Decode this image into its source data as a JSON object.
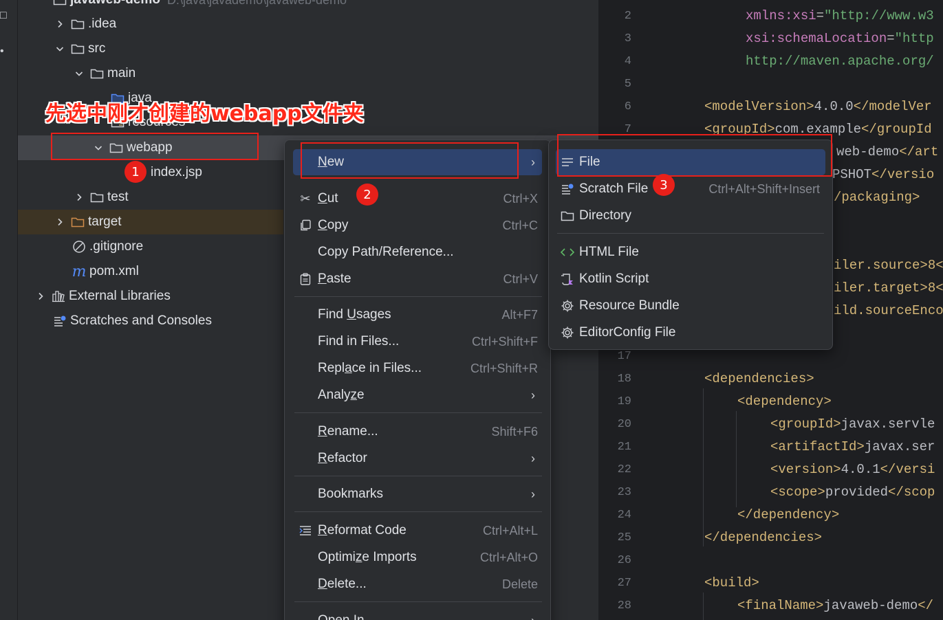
{
  "tree": {
    "root_label": "javaweb-demo",
    "root_path": "D:\\java\\javademo\\javaweb-demo",
    "items": [
      {
        "label": ".idea"
      },
      {
        "label": "src"
      },
      {
        "label": "main"
      },
      {
        "label": "java"
      },
      {
        "label": "resources"
      },
      {
        "label": "webapp"
      },
      {
        "label": "index.jsp"
      },
      {
        "label": "test"
      },
      {
        "label": "target"
      },
      {
        "label": ".gitignore"
      },
      {
        "label": "pom.xml"
      },
      {
        "label": "External Libraries"
      },
      {
        "label": "Scratches and Consoles"
      }
    ]
  },
  "annotation": {
    "callout": "先选中刚才创建的webapp文件夹",
    "badges": [
      "1",
      "2",
      "3"
    ]
  },
  "context_menu": {
    "items": [
      {
        "label": "New",
        "mnemonic_prefix": "",
        "mnemonic": "N",
        "rest": "ew",
        "shortcut": "",
        "submenu": true
      },
      {
        "label": "Cut",
        "prefix": "",
        "mnemonic": "C",
        "rest": "ut",
        "shortcut": "Ctrl+X"
      },
      {
        "label": "Copy",
        "prefix": "",
        "mnemonic": "C",
        "rest": "opy",
        "shortcut": "Ctrl+C"
      },
      {
        "label": "Copy Path/Reference...",
        "shortcut": ""
      },
      {
        "label": "Paste",
        "prefix": "",
        "mnemonic": "P",
        "rest": "aste",
        "shortcut": "Ctrl+V"
      },
      {
        "label": "Find Usages",
        "prefix": "Find ",
        "mnemonic": "U",
        "rest": "sages",
        "shortcut": "Alt+F7"
      },
      {
        "label": "Find in Files...",
        "shortcut": "Ctrl+Shift+F"
      },
      {
        "label": "Replace in Files...",
        "prefix": "Repl",
        "mnemonic": "a",
        "rest": "ce in Files...",
        "shortcut": "Ctrl+Shift+R"
      },
      {
        "label": "Analyze",
        "prefix": "Analy",
        "mnemonic": "z",
        "rest": "e",
        "submenu": true
      },
      {
        "label": "Rename...",
        "prefix": "",
        "mnemonic": "R",
        "rest": "ename...",
        "shortcut": "Shift+F6"
      },
      {
        "label": "Refactor",
        "prefix": "",
        "mnemonic": "R",
        "rest": "efactor",
        "submenu": true
      },
      {
        "label": "Bookmarks",
        "submenu": true
      },
      {
        "label": "Reformat Code",
        "prefix": "",
        "mnemonic": "R",
        "rest": "eformat Code",
        "shortcut": "Ctrl+Alt+L"
      },
      {
        "label": "Optimize Imports",
        "prefix": "Optimi",
        "mnemonic": "z",
        "rest": "e Imports",
        "shortcut": "Ctrl+Alt+O"
      },
      {
        "label": "Delete...",
        "prefix": "",
        "mnemonic": "D",
        "rest": "elete...",
        "shortcut": "Delete"
      },
      {
        "label": "Open In",
        "submenu": true
      }
    ]
  },
  "new_submenu": {
    "items": [
      {
        "label": "File",
        "shortcut": ""
      },
      {
        "label": "Scratch File",
        "shortcut": "Ctrl+Alt+Shift+Insert"
      },
      {
        "label": "Directory",
        "shortcut": ""
      },
      {
        "label": "HTML File",
        "shortcut": ""
      },
      {
        "label": "Kotlin Script",
        "shortcut": ""
      },
      {
        "label": "Resource Bundle",
        "shortcut": ""
      },
      {
        "label": "EditorConfig File",
        "shortcut": ""
      }
    ]
  },
  "editor": {
    "line_numbers": [
      "2",
      "3",
      "4",
      "5",
      "6",
      "7",
      "17",
      "18",
      "19",
      "20",
      "21",
      "22",
      "23",
      "24",
      "25",
      "26",
      "27",
      "28"
    ],
    "lines": {
      "l2": {
        "ns": "xmlns:xsi",
        "eq": "=",
        "val": "\"http://www.w3"
      },
      "l3": {
        "ns": "xsi:schemaLocation",
        "eq": "=",
        "val": "\"http"
      },
      "l4": {
        "val": "http://maven.apache.org/"
      },
      "l6": {
        "open": "<modelVersion>",
        "text": "4.0.0",
        "close": "</modelVer"
      },
      "l7": {
        "open": "<groupId>",
        "text": "com.example",
        "close": "</groupId"
      },
      "l8": {
        "text": "web-demo",
        "close": "</art"
      },
      "l9": {
        "text": "PSHOT",
        "close": "</versio"
      },
      "l10": {
        "close": "/packaging>"
      },
      "l13": {
        "text": "iler.source>8<"
      },
      "l14": {
        "text": "iler.target>8<"
      },
      "l15": {
        "text": "ild.sourceEnco"
      },
      "l18": {
        "open": "<dependencies>"
      },
      "l19": {
        "open": "<dependency>"
      },
      "l20": {
        "open": "<groupId>",
        "text": "javax.servle"
      },
      "l21": {
        "open": "<artifactId>",
        "text": "javax.ser"
      },
      "l22": {
        "open": "<version>",
        "text": "4.0.1",
        "close": "</versi"
      },
      "l23": {
        "open": "<scope>",
        "text": "provided",
        "close": "</scop"
      },
      "l24": {
        "close": "</dependency>"
      },
      "l25": {
        "close": "</dependencies>"
      },
      "l27": {
        "open": "<build>"
      },
      "l28": {
        "open": "<finalName>",
        "text": "javaweb-demo",
        "close": "</"
      }
    }
  },
  "colors": {
    "accent_red": "#e8201a",
    "selection_blue": "#2e436e",
    "tag": "#d5b778",
    "string": "#6aab73",
    "namespace": "#c77dbb"
  }
}
